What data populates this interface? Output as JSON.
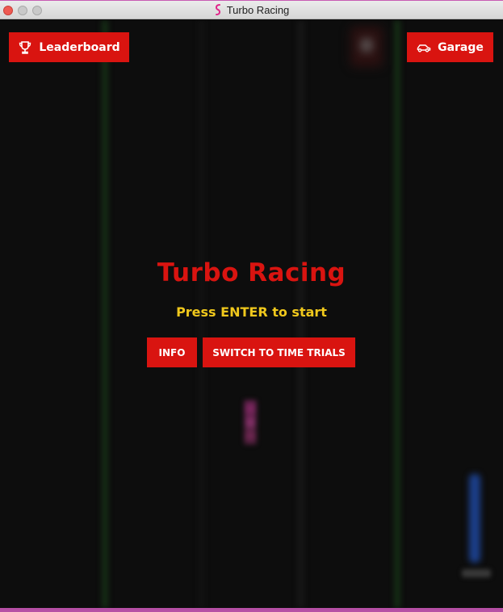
{
  "window": {
    "title": "Turbo Racing",
    "app_icon": "hook-icon"
  },
  "header": {
    "leaderboard_label": "Leaderboard",
    "leaderboard_icon": "trophy-icon",
    "garage_label": "Garage",
    "garage_icon": "car-icon"
  },
  "menu": {
    "title": "Turbo Racing",
    "prompt": "Press ENTER to start",
    "info_label": "INFO",
    "switch_label": "SWITCH TO TIME TRIALS"
  },
  "colors": {
    "accent_red": "#d91410",
    "prompt_yellow": "#f0c81c",
    "background": "#0d0d0d",
    "frame_pink": "#b64fa5"
  }
}
